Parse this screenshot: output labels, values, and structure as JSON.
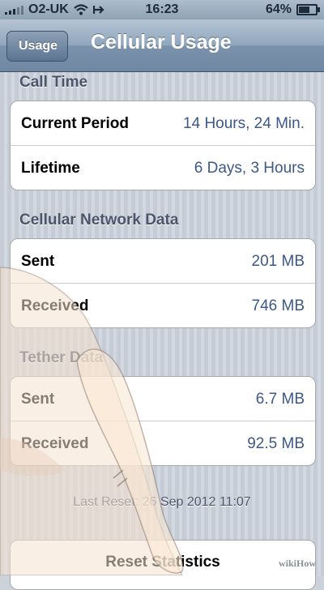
{
  "status_bar": {
    "carrier": "O2-UK",
    "time": "16:23",
    "battery": "64%",
    "battery_level": 0.64,
    "signal_icon": "signal-bars-icon",
    "wifi_icon": "wifi-icon",
    "location_icon": "location-arrow-icon",
    "battery_icon": "battery-icon"
  },
  "nav": {
    "back_label": "Usage",
    "title": "Cellular Usage"
  },
  "sections": [
    {
      "header": "Call Time",
      "rows": [
        {
          "label": "Current Period",
          "value": "14 Hours, 24 Min."
        },
        {
          "label": "Lifetime",
          "value": "6 Days, 3 Hours"
        }
      ]
    },
    {
      "header": "Cellular Network Data",
      "rows": [
        {
          "label": "Sent",
          "value": "201 MB"
        },
        {
          "label": "Received",
          "value": "746 MB"
        }
      ]
    },
    {
      "header": "Tether Data",
      "rows": [
        {
          "label": "Sent",
          "value": "6.7 MB"
        },
        {
          "label": "Received",
          "value": "92.5 MB"
        }
      ]
    }
  ],
  "last_reset": "Last Reset: 26 Sep 2012 11:07",
  "reset_button": "Reset Statistics",
  "watermark": "wikiHow",
  "colors": {
    "value_text": "#3c5888",
    "nav_bar": "#7a92ab"
  }
}
